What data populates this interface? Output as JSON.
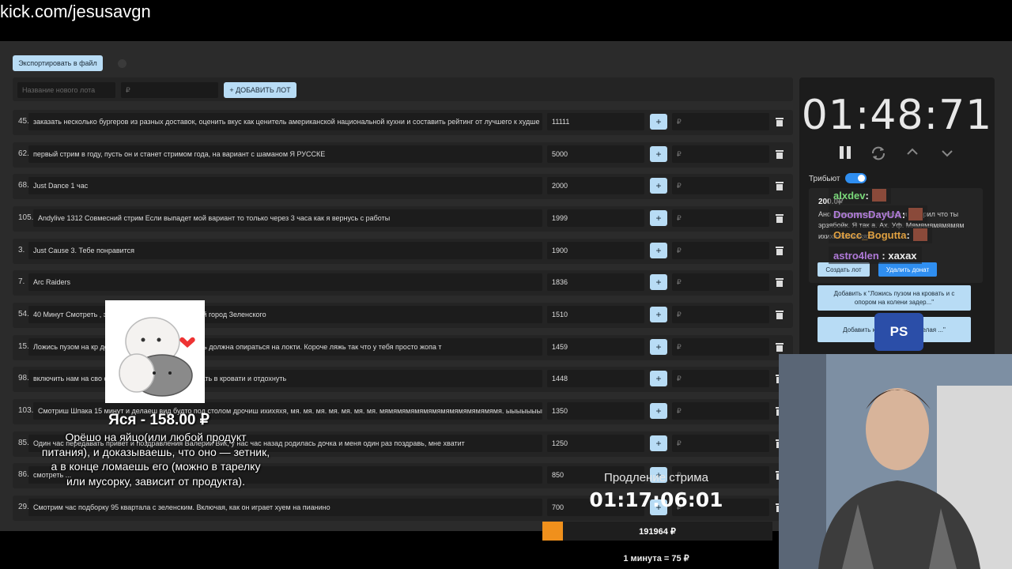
{
  "browser": {
    "url": "kick.com/jesusavgn"
  },
  "toolbar": {
    "export_label": "Экспортировать в файл"
  },
  "add_lot": {
    "name_placeholder": "Название нового лота",
    "amount_placeholder": "₽",
    "button_label": "+ ДОБАВИТЬ ЛОТ"
  },
  "lots": [
    {
      "num": "45.",
      "name": "заказать несколько бургеров из разных доставок, оценить вкус как ценитель американской национальной кухни и составить рейтинг от лучшего к худше",
      "amount": "11111"
    },
    {
      "num": "62.",
      "name": "первый стрим в году, пусть он и станет стримом года, на вариант с шаманом Я РУССКЕ",
      "amount": "5000"
    },
    {
      "num": "68.",
      "name": "Just Dance 1 час",
      "amount": "2000"
    },
    {
      "num": "105.",
      "name": "Andylive 1312 Совмесний стрим Если выпадет мой вариант то только через 3 часа как я вернусь с работы",
      "amount": "1999"
    },
    {
      "num": "3.",
      "name": "Just Cause 3. Тебе понравится",
      "amount": "1900"
    },
    {
      "num": "7.",
      "name": "Arc Raiders",
      "amount": "1836"
    },
    {
      "num": "54.",
      "name": "40 Минут Смотреть                                                , это мой родной город + родной город Зеленского",
      "amount": "1510"
    },
    {
      "num": "15.",
      "name": "Ложись пузом на кр                                          дери жопу. Передняя твоя часть должна опираться на локти. Короче ляжь так что у тебя просто жопа т",
      "amount": "1459"
    },
    {
      "num": "98.",
      "name": "включить нам на сво                                          самому пойти на 1 час полежать в кровати и отдохнуть",
      "amount": "1448"
    },
    {
      "num": "103.",
      "name": "Смотриш Шпака 15 минут и делаеш вид будто под столом дрочиш ихихяхя, мя. мя. мя. мя. мя. мя. мя. мямямямямямямямямямямямямямя. ыыыыыыыы",
      "amount": "1350"
    },
    {
      "num": "85.",
      "name": "Один час передавать привет и поздравления Валерии Вик, у нас час назад родилась дочка и меня один раз поздравь, мне хватит",
      "amount": "1250"
    },
    {
      "num": "86.",
      "name": "смотреть ...",
      "amount": "850"
    },
    {
      "num": "29.",
      "name": "Смотрим час подборку 95 квартала с зеленским. Включая, как он играет хуем на пианино",
      "amount": "700"
    }
  ],
  "currency_placeholder": "₽",
  "plus_label": "+",
  "panel": {
    "timer": "01:48:71",
    "tribute_label": "Трибьют",
    "donation": {
      "amount": "200.0₽",
      "text": "Ано                                  лежал попой к верху и говорил что ты эрзябойк. Я так                                 а. Ах. Уф. Мямямямямямям ихихихяхяхяхяхя",
      "create_lot_label": "Создать лот",
      "delete_label": "Удалить донат"
    },
    "match_buttons": [
      "Добавить к \"Ложись пузом на кровать и с опором на колени задер...\"",
      "Добавить к \"Ча                      кровать и делая                        ...\""
    ]
  },
  "chat": [
    {
      "user": "alxdev",
      "msg": "",
      "color": "#7ad97a"
    },
    {
      "user": "DoomsDayUA",
      "msg": "",
      "color": "#b07ad9"
    },
    {
      "user": "Otecc_Bogutta",
      "msg": "",
      "color": "#e0a040"
    },
    {
      "user": "astro4len",
      "msg": "хахах",
      "color": "#b07ad9"
    }
  ],
  "alert": {
    "title": "Яся - 158.00 ₽",
    "text": "Орёшо на яйцо(или любой продукт питания), и доказываешь, что оно — зетник, а в конце ломаешь его (можно в тарелку или мусорку, зависит от продукта)."
  },
  "extension": {
    "label": "Продление стрима",
    "timer": "01:17:06:01",
    "total": "191964 ₽",
    "progress_fraction": 0.09,
    "rate": "1 минута = 75 ₽"
  },
  "overlay": {
    "ps_label": "PS"
  },
  "colors": {
    "accent": "#b8dcf5",
    "toggle": "#2f8ef0",
    "progress": "#f0901c",
    "delete": "#2f8ef0"
  }
}
